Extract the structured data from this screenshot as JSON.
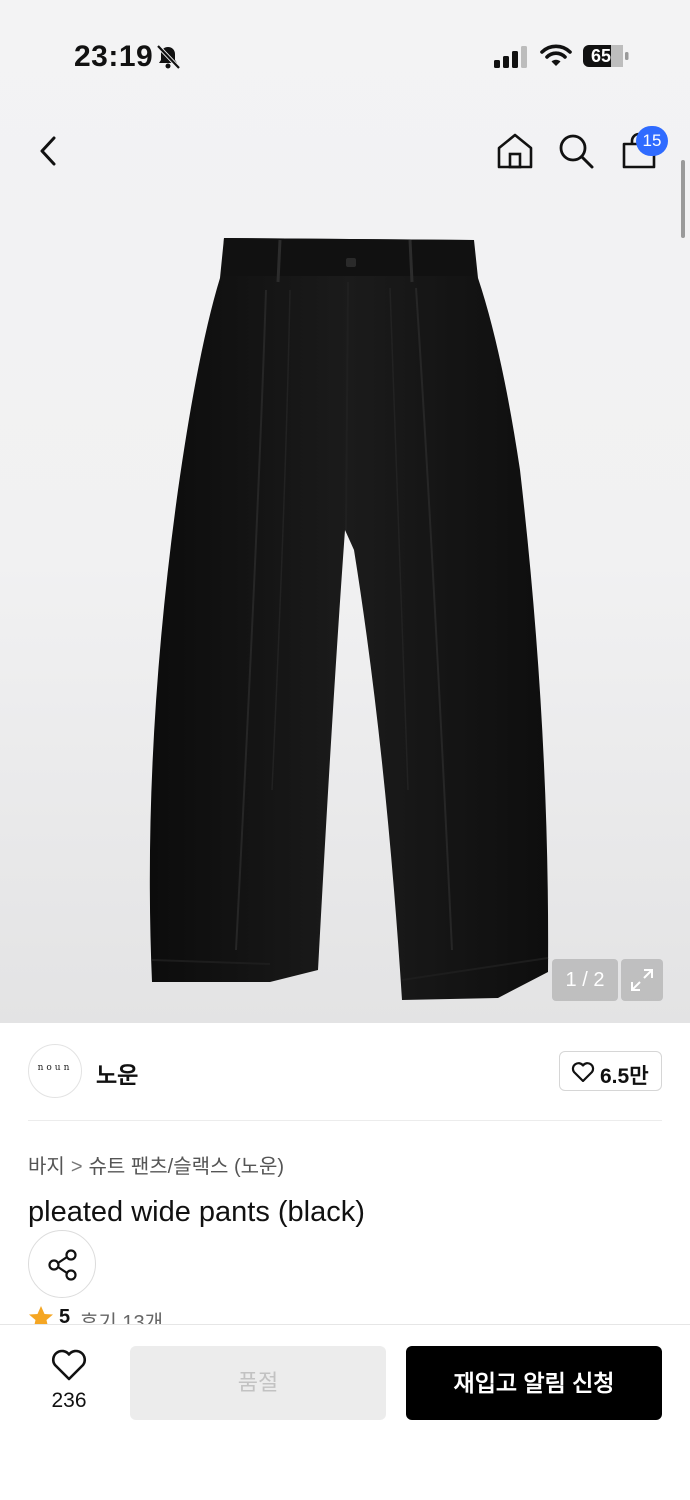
{
  "status_bar": {
    "time": "23:19",
    "battery": "65",
    "icons": [
      "bell-off-icon",
      "signal-icon",
      "wifi-icon",
      "battery-icon"
    ]
  },
  "nav": {
    "icons": [
      "back-icon",
      "home-icon",
      "search-icon",
      "shopping-bag-icon"
    ],
    "cart_badge": "15"
  },
  "gallery": {
    "counter": "1 / 2",
    "expand_icon": "expand-icon"
  },
  "brand": {
    "logo_text": "noun",
    "name": "노운",
    "like_count": "6.5만"
  },
  "breadcrumb": {
    "items": [
      "바지",
      "슈트 팬츠/슬랙스 (노운)"
    ],
    "separator": ">"
  },
  "product": {
    "title": "pleated wide pants (black)",
    "rating": "5",
    "reviews": "후기 13개"
  },
  "bottom_bar": {
    "wish_count": "236",
    "soldout_label": "품절",
    "restock_label": "재입고 알림 신청"
  },
  "colors": {
    "accent_badge": "#2f6bff",
    "star": "#f5a623",
    "primary_button": "#000000",
    "disabled_button": "#ececec"
  }
}
